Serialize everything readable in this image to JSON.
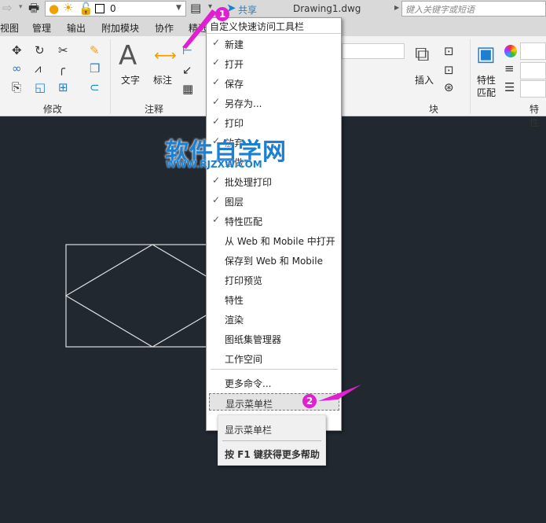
{
  "qat": {
    "layer_value": "0",
    "share_label": "共享",
    "doc_title": "Drawing1.dwg",
    "search_placeholder": "键入关键字或短语"
  },
  "tabs": [
    "视图",
    "管理",
    "输出",
    "附加模块",
    "协作",
    "精选"
  ],
  "ribbon": {
    "modify_group": "修改",
    "annotate_group": "注释",
    "text_label": "文字",
    "dim_label": "标注",
    "block_group": "块",
    "insert_label": "插入",
    "matchprop_label_1": "特性",
    "matchprop_label_2": "匹配",
    "props_group": "特性"
  },
  "menu": {
    "header": "自定义快速访问工具栏",
    "items": [
      {
        "label": "新建",
        "checked": true
      },
      {
        "label": "打开",
        "checked": true
      },
      {
        "label": "保存",
        "checked": true
      },
      {
        "label": "另存为...",
        "checked": true
      },
      {
        "label": "打印",
        "checked": true
      },
      {
        "label": "放弃",
        "checked": true
      },
      {
        "label": "重做",
        "checked": true
      },
      {
        "label": "批处理打印",
        "checked": true
      },
      {
        "label": "图层",
        "checked": true
      },
      {
        "label": "特性匹配",
        "checked": true
      },
      {
        "label": "从 Web 和 Mobile 中打开",
        "checked": false
      },
      {
        "label": "保存到 Web 和 Mobile",
        "checked": false
      },
      {
        "label": "打印预览",
        "checked": false
      },
      {
        "label": "特性",
        "checked": false
      },
      {
        "label": "渲染",
        "checked": false
      },
      {
        "label": "图纸集管理器",
        "checked": false
      },
      {
        "label": "工作空间",
        "checked": false
      }
    ],
    "more": "更多命令...",
    "show_menubar": "显示菜单栏"
  },
  "tooltip": {
    "title": "显示菜单栏",
    "help": "按 F1 键获得更多帮助"
  },
  "watermark": {
    "title": "软件自学网",
    "url": "WWW.RJZXW.COM"
  },
  "annotations": {
    "step1": "1",
    "step2": "2"
  },
  "colors": {
    "canvas": "#212830",
    "accent": "#1d7fd0",
    "annotation": "#e020d0"
  }
}
